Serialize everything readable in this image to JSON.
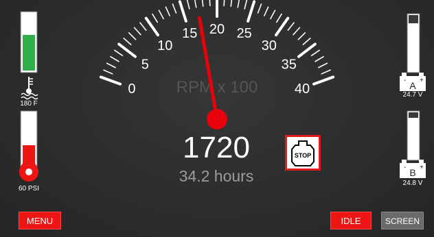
{
  "gauge": {
    "ticks_major": [
      "0",
      "5",
      "10",
      "15",
      "20",
      "25",
      "30",
      "35",
      "40"
    ],
    "unit_label": "RPM x 100",
    "rpm_display": "1720",
    "rpm_value": 17.2,
    "hours_display": "34.2 hours"
  },
  "left": {
    "temp_level": 0.5,
    "temp_label": "180 F",
    "oil_level": 0.4,
    "oil_label": "60 PSI"
  },
  "right": {
    "battery_a": {
      "letter": "A",
      "level": 0.95,
      "voltage": "24.7 V"
    },
    "battery_b": {
      "letter": "B",
      "level": 0.95,
      "voltage": "24.8 V"
    }
  },
  "buttons": {
    "menu": "MENU",
    "idle": "IDLE",
    "screen": "SCREEN",
    "stop": "STOP"
  },
  "colors": {
    "accent_red": "#ee1515",
    "temp_green": "#2fae4a",
    "gauge_tick": "#ffffff",
    "needle": "#e8000a"
  }
}
